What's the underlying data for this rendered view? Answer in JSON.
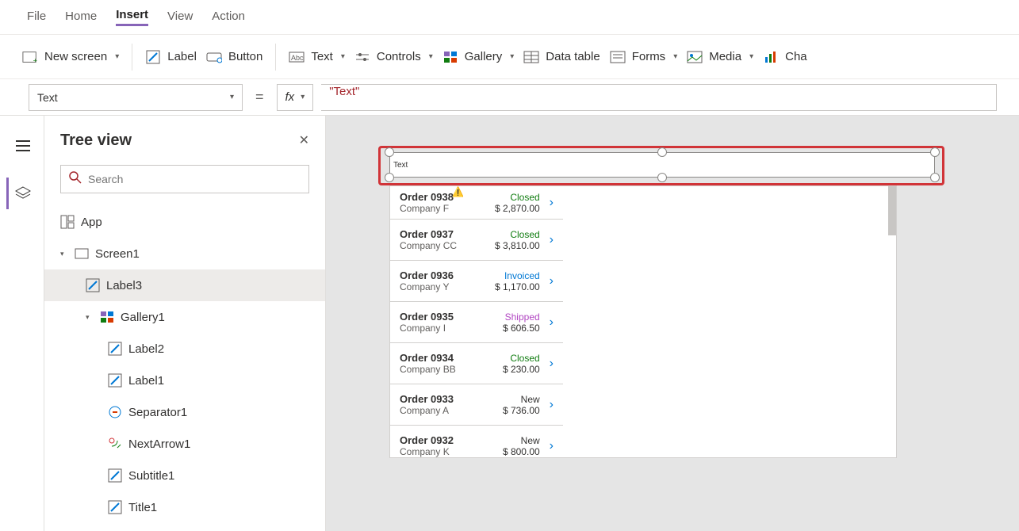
{
  "menu": [
    "File",
    "Home",
    "Insert",
    "View",
    "Action"
  ],
  "menu_active": "Insert",
  "ribbon": {
    "newScreen": "New screen",
    "label": "Label",
    "button": "Button",
    "text": "Text",
    "controls": "Controls",
    "gallery": "Gallery",
    "dataTable": "Data table",
    "forms": "Forms",
    "media": "Media",
    "charts": "Cha"
  },
  "formula": {
    "property": "Text",
    "fx": "fx",
    "value": "\"Text\""
  },
  "tree": {
    "title": "Tree view",
    "search_placeholder": "Search",
    "nodes": {
      "app": "App",
      "screen1": "Screen1",
      "label3": "Label3",
      "gallery1": "Gallery1",
      "label2": "Label2",
      "label1": "Label1",
      "separator1": "Separator1",
      "nextArrow1": "NextArrow1",
      "subtitle1": "Subtitle1",
      "title1": "Title1"
    }
  },
  "canvas": {
    "labelText": "Text"
  },
  "gallery_items": [
    {
      "order": "Order 0938",
      "company": "Company F",
      "status": "Closed",
      "statusClass": "st-closed",
      "amount": "$ 2,870.00",
      "warn": true
    },
    {
      "order": "Order 0937",
      "company": "Company CC",
      "status": "Closed",
      "statusClass": "st-closed",
      "amount": "$ 3,810.00"
    },
    {
      "order": "Order 0936",
      "company": "Company Y",
      "status": "Invoiced",
      "statusClass": "st-invoiced",
      "amount": "$ 1,170.00"
    },
    {
      "order": "Order 0935",
      "company": "Company I",
      "status": "Shipped",
      "statusClass": "st-shipped",
      "amount": "$ 606.50"
    },
    {
      "order": "Order 0934",
      "company": "Company BB",
      "status": "Closed",
      "statusClass": "st-closed",
      "amount": "$ 230.00"
    },
    {
      "order": "Order 0933",
      "company": "Company A",
      "status": "New",
      "statusClass": "st-new",
      "amount": "$ 736.00"
    },
    {
      "order": "Order 0932",
      "company": "Company K",
      "status": "New",
      "statusClass": "st-new",
      "amount": "$ 800.00"
    }
  ]
}
